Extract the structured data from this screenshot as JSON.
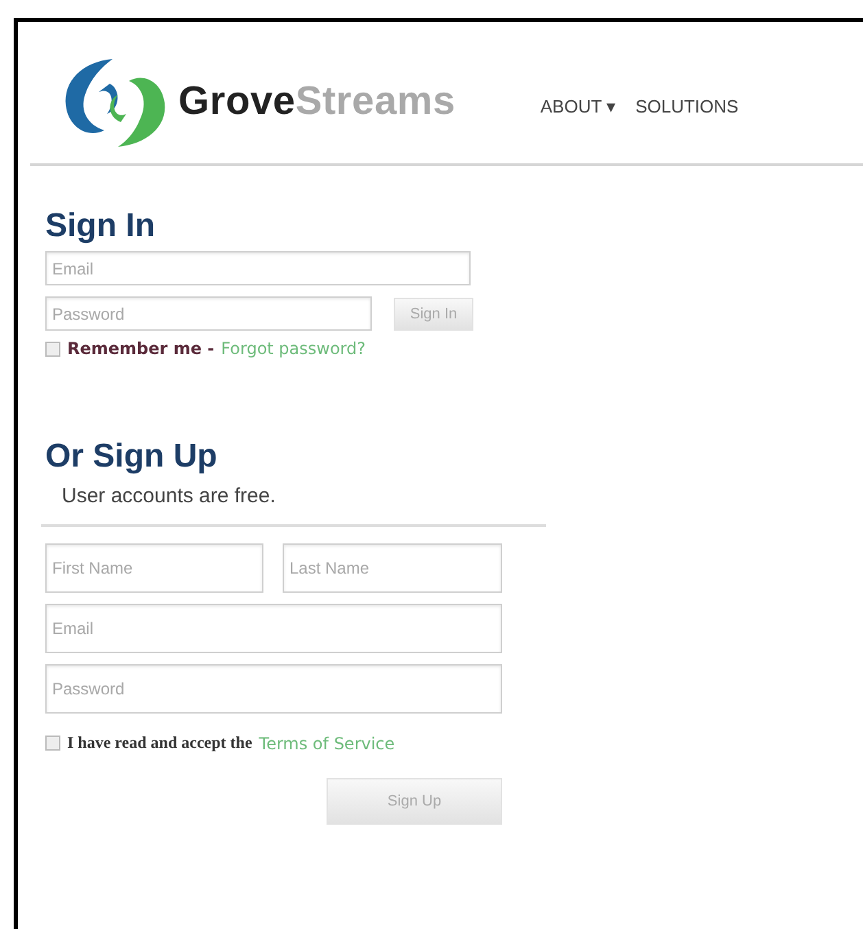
{
  "header": {
    "logo_bold": "Grove",
    "logo_light": "Streams",
    "nav": [
      {
        "label": "ABOUT",
        "caret": "▾"
      },
      {
        "label": "SOLUTIONS"
      }
    ]
  },
  "sign_in": {
    "title": "Sign In",
    "email": {
      "placeholder": "Email"
    },
    "password": {
      "placeholder": "Password"
    },
    "button": "Sign In",
    "remember": {
      "label": "Remember me -",
      "checked": false
    },
    "forgot_link": "Forgot password?"
  },
  "sign_up": {
    "title": "Or Sign Up",
    "subtitle": "User accounts are free.",
    "first_name": {
      "placeholder": "First Name"
    },
    "last_name": {
      "placeholder": "Last Name"
    },
    "email": {
      "placeholder": "Email"
    },
    "password": {
      "placeholder": "Password"
    },
    "terms": {
      "label": "I have read and accept the",
      "checked": false
    },
    "terms_link": "Terms of Service",
    "button": "Sign Up"
  }
}
